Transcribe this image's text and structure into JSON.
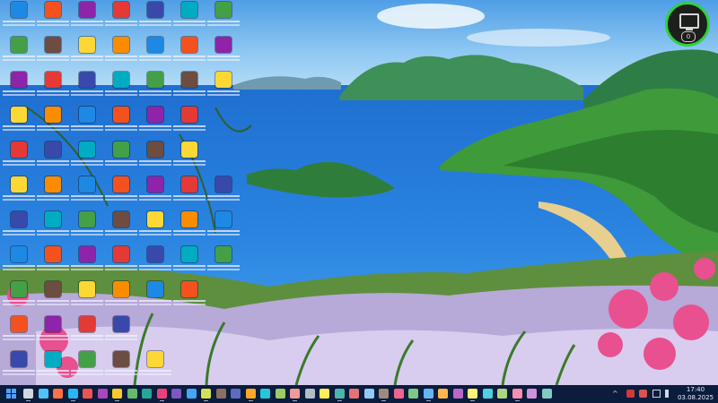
{
  "taskbar": {
    "clock": {
      "time": "17:40",
      "date": "03.08.2025"
    }
  },
  "widget": {
    "counter": "0"
  },
  "colors": {
    "taskbar": "#0b1c3d",
    "widget_ring": "#2fd23b",
    "start_blue": "#4fa3ff"
  },
  "icons": {
    "desktop": [
      "monitor-icon",
      "ccleaner-icon",
      "filezilla-icon",
      "edge-icon",
      "app-icon",
      "app-icon",
      "app-icon",
      "network-icon",
      "app-icon",
      "chrome-icon",
      "app-icon",
      "app-icon",
      "app-icon",
      "app-icon",
      "app-icon",
      "app-icon",
      "firefox-icon",
      "app-icon",
      "vlc-icon",
      "app-icon",
      "app-icon",
      "app-icon",
      "app-icon",
      "app-icon",
      "app-icon",
      "app-icon",
      "app-icon",
      "app-icon",
      "app-icon",
      "app-icon",
      "app-icon",
      "app-icon",
      "vivaldi-icon",
      "app-icon",
      "app-icon",
      "chrome-icon",
      "app-icon",
      "app-icon",
      "app-icon",
      "whatsapp-icon",
      "app-icon",
      "app-icon",
      "app-icon",
      "app-icon",
      "app-icon",
      "app-icon",
      "app-icon",
      "app-icon",
      "app-icon",
      "app-icon",
      "app-icon",
      "app-icon",
      "app-icon",
      "app-icon",
      "app-icon",
      "app-icon",
      "app-icon",
      "app-icon",
      "app-icon",
      "app-icon",
      "app-icon",
      "app-icon",
      "app-icon",
      "app-icon",
      "app-icon",
      "app-icon",
      "app-icon",
      "app-icon",
      "app-icon"
    ]
  }
}
